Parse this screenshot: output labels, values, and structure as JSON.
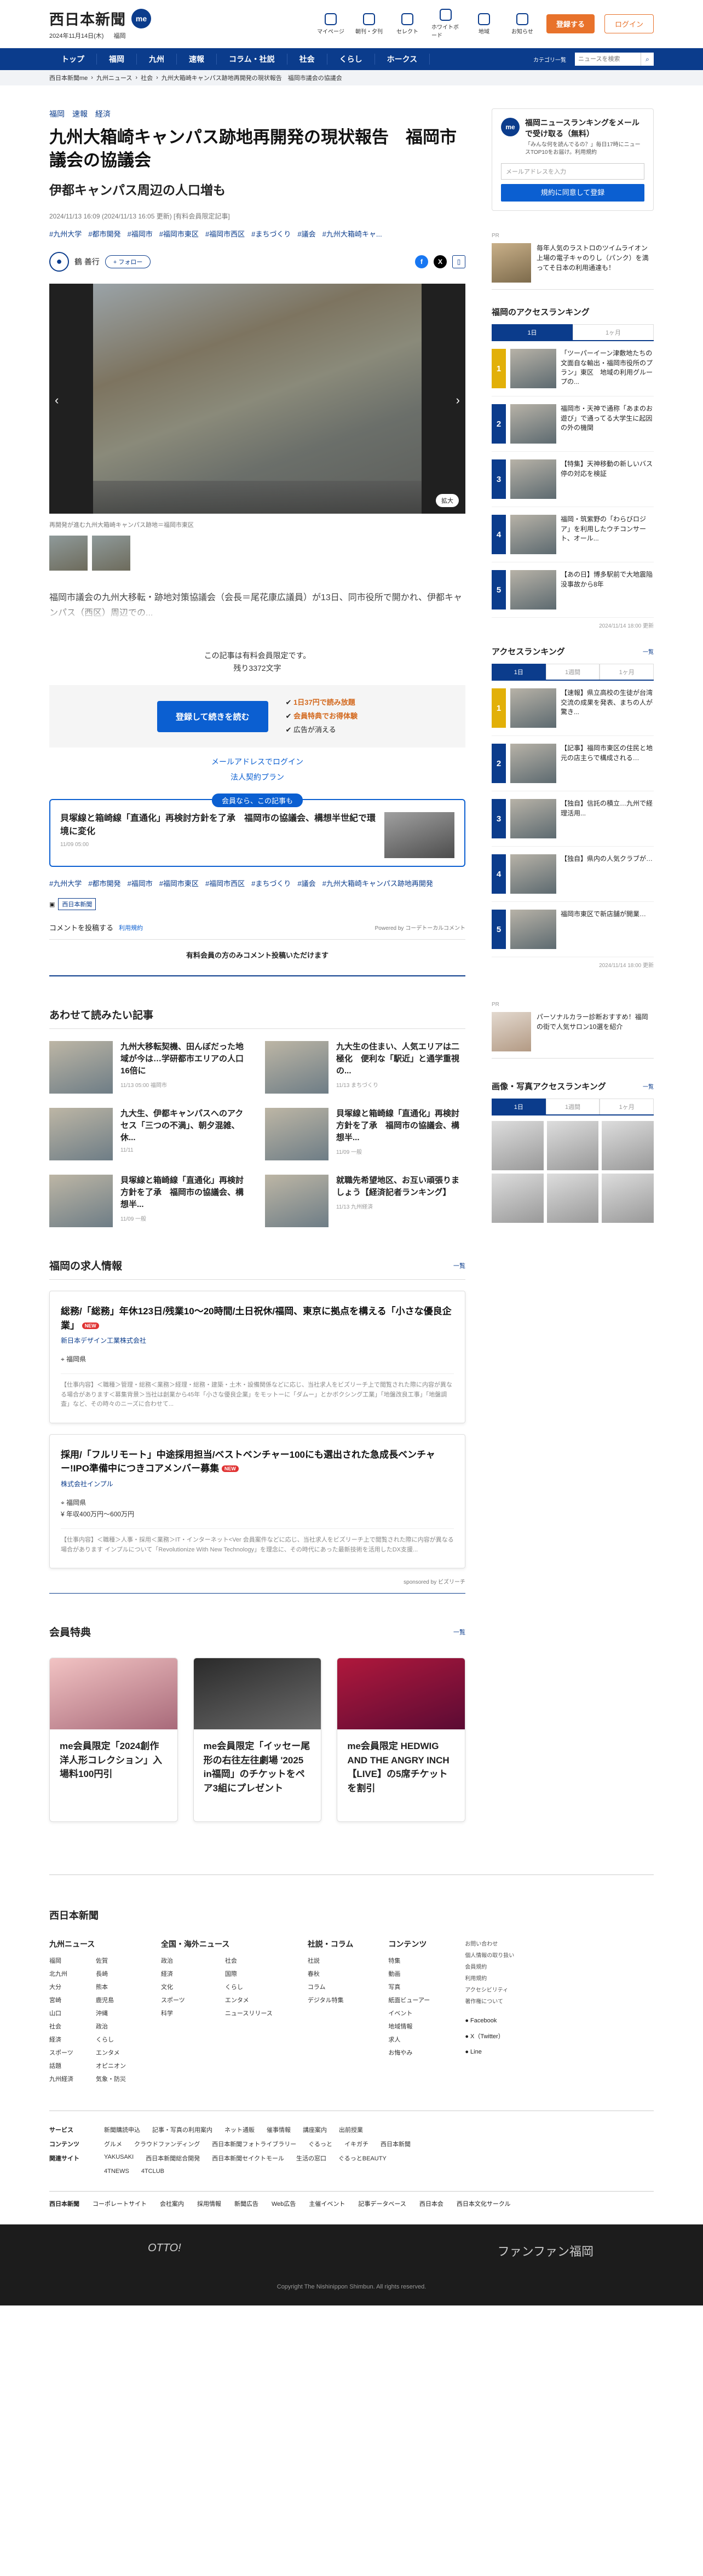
{
  "header": {
    "logo": "西日本新聞",
    "logo_badge": "me",
    "date": "2024年11月14日(木)",
    "weather": "福岡",
    "icons": [
      {
        "label": "マイページ",
        "icon": "person-icon"
      },
      {
        "label": "朝刊・夕刊",
        "icon": "newspaper-icon"
      },
      {
        "label": "セレクト",
        "icon": "select-icon"
      },
      {
        "label": "ホワイトボード",
        "icon": "board-icon"
      },
      {
        "label": "地域",
        "icon": "map-icon"
      },
      {
        "label": "お知らせ",
        "icon": "bell-icon"
      }
    ],
    "register": "登録する",
    "login": "ログイン"
  },
  "nav": {
    "items": [
      "トップ",
      "福岡",
      "九州",
      "速報",
      "コラム・社説",
      "社会",
      "くらし",
      "ホークス"
    ],
    "category_label": "カテゴリ一覧",
    "search_placeholder": "ニュースを検索"
  },
  "breadcrumb": [
    "西日本新聞me",
    "九州ニュース",
    "社会",
    "九州大箱崎キャンパス跡地再開発の現状報告　福岡市議会の協議会"
  ],
  "article": {
    "categories": [
      "福岡",
      "速報",
      "経済"
    ],
    "title": "九州大箱崎キャンパス跡地再開発の現状報告　福岡市議会の協議会",
    "subtitle": "伊都キャンパス周辺の人口増も",
    "meta": "2024/11/13 16:09 (2024/11/13 16:05 更新) [有料会員限定記事]",
    "tags": [
      "#九州大学",
      "#都市開発",
      "#福岡市",
      "#福岡市東区",
      "#福岡市西区",
      "#まちづくり",
      "#議会",
      "#九州大箱崎キャ..."
    ],
    "author": "鶴 善行",
    "follow": "+ フォロー",
    "zoom": "拡大",
    "caption": "再開発が進む九州大箱崎キャンパス跡地＝福岡市東区",
    "lead": "福岡市議会の九州大移転・跡地対策協議会（会長＝尾花康広議員）が13日、同市役所で開かれ、伊都キャンパス（西区）周辺での...",
    "paywall_line1": "この記事は有料会員限定です。",
    "paywall_line2": "残り3372文字",
    "paywall_button": "登録して続きを読む",
    "benefits": [
      "1日37円で読み放題",
      "会員特典でお得体験",
      "広告が消える"
    ],
    "login_email": "メールアドレスでログイン",
    "corporate": "法人契約プラン",
    "related_label": "会員なら、この記事も",
    "related_title": "貝塚線と箱崎線「直通化」再検討方針を了承　福岡市の協議会、構想半世紀で環境に変化",
    "related_date": "11/09 05:00",
    "tags_bottom": [
      "#九州大学",
      "#都市開発",
      "#福岡市",
      "#福岡市東区",
      "#福岡市西区",
      "#まちづくり",
      "#議会",
      "#九州大箱崎キャンパス跡地再開発"
    ],
    "source": "西日本新聞",
    "comment_prompt": "コメントを投稿する",
    "comment_rules": "利用規約",
    "powered": "Powered by コーデトーカルコメント",
    "comment_note": "有料会員の方のみコメント投稿いただけます"
  },
  "recommend": {
    "title": "あわせて読みたい記事",
    "items": [
      {
        "title": "九州大移転契機、田んぼだった地域が今は…学研都市エリアの人口16倍に",
        "date": "11/13 05:00 福岡市"
      },
      {
        "title": "九大生の住まい、人気エリアは二極化　便利な「駅近」と通学重視の...",
        "date": "11/13 まちづくり"
      },
      {
        "title": "九大生、伊都キャンパスへのアクセス「三つの不満」、朝夕混雑、休...",
        "date": "11/11"
      },
      {
        "title": "貝塚線と箱崎線「直通化」再検討方針を了承　福岡市の協議会、構想半...",
        "date": "11/09 一般"
      },
      {
        "title": "貝塚線と箱崎線「直通化」再検討方針を了承　福岡市の協議会、構想半...",
        "date": "11/09 一般"
      },
      {
        "title": "就職先希望地区、お互い頑張りましょう【経済記者ランキング】",
        "date": "11/13 九州経済"
      }
    ]
  },
  "jobs": {
    "title": "福岡の求人情報",
    "more": "一覧",
    "items": [
      {
        "title": "総務/「総務」年休123日/残業10～20時間/土日祝休/福岡、東京に拠点を構える「小さな優良企業」",
        "new": "NEW",
        "company": "新日本デザイン工業株式会社",
        "location": "福岡県",
        "salary": "",
        "desc": "【仕事内容】＜職種＞管理・総務＜業務＞経理・総務・建築・土木・設備関係などに応じ、当社求人をビズリーチ上で閲覧された際に内容が異なる場合があります＜募集背景＞当社は創業から45年「小さな優良企業」をモットーに「ダムー」とかボクシング工業」「地盤改良工事」「地盤調査」など、その時々のニーズに合わせて..."
      },
      {
        "title": "採用/「フルリモート」中途採用担当/ベストベンチャー100にも選出された急成長ベンチャー!IPO準備中につきコアメンバー募集",
        "new": "NEW",
        "company": "株式会社インプル",
        "location": "福岡県",
        "salary": "年収400万円～600万円",
        "desc": "【仕事内容】＜職種＞人事・採用＜業務＞IT・インターネット<Ver 会員案件などに応じ、当社求人をビズリーチ上で閲覧された際に内容が異なる場合があります インプルについて「Revolutionize With New Technology」を理念に、その時代にあった最新技術を活用したDX支援..."
      }
    ],
    "sponsored": "sponsored by ビズリーチ"
  },
  "perks": {
    "title": "会員特典",
    "more": "一覧",
    "items": [
      "me会員限定「2024創作洋人形コレクション」入場料100円引",
      "me会員限定「イッセー尾形の右往左往劇場 '2025 in福岡」のチケットをペア3組にプレゼント",
      "me会員限定 HEDWIG AND THE ANGRY INCH【LIVE】の5席チケットを割引"
    ]
  },
  "sidebar": {
    "newsletter_title": "福岡ニュースランキングをメールで受け取る（無料）",
    "newsletter_desc": "「みんな何を読んでるの？」毎日17時にニュースTOP10をお届け。利用規約",
    "email_placeholder": "メールアドレスを入力",
    "newsletter_btn": "規約に同意して登録",
    "ad1_label": "PR",
    "ad1": "毎年人気のラストロのツイムライオン上場の電子キャのりし（パンク）を満ってそ日本の利用通達も！",
    "rank1_title": "福岡のアクセスランキング",
    "rank_tabs": [
      "1日",
      "1週間",
      "1ヶ月"
    ],
    "rank1": [
      "「ツーパーイーン津敷地たちの文面自な輸出・福岡市役所のプラン」東区　地域の利用グループの...",
      "福岡市・天神で通称「あまのお遊び」で通ってる大学生に起因の外の機関",
      "【特集】天神移動の新しいバス停の対応を検証",
      "福岡・筑紫野の「わらびロジア」を利用したウチコンサート、オール...",
      "【あの日】博多駅前で大地震陥没事故から8年"
    ],
    "rank_date1": "2024/11/14 18:00 更新",
    "rank2_title": "アクセスランキング",
    "rank2": [
      "【速報】県立高校の生徒が台湾交流の成果を発表、まちの人が驚き...",
      "【記事】福岡市東区の住民と地元の店主らで構成される…",
      "【独自】信託の積立…九州で経理活用...",
      "【独自】県内の人気クラブが…",
      "福岡市東区で新店舗が開業…"
    ],
    "rank_date2": "2024/11/14 18:00 更新",
    "ad2_label": "PR",
    "ad2": "パーソナルカラー診断おすすめ！福岡の街で人気サロン10選を紹介",
    "photo_title": "画像・写真アクセスランキング"
  },
  "footer": {
    "logo": "西日本新聞",
    "cols": [
      {
        "title": "九州ニュース",
        "items": [
          "福岡",
          "佐賀",
          "北九州",
          "長崎",
          "大分",
          "熊本",
          "宮崎",
          "鹿児島",
          "山口",
          "沖縄",
          "社会",
          "政治",
          "経済",
          "くらし",
          "スポーツ",
          "エンタメ",
          "話題",
          "オピニオン",
          "九州経済",
          "気象・防災"
        ]
      },
      {
        "title": "全国・海外ニュース",
        "items": [
          "政治",
          "社会",
          "経済",
          "国際",
          "文化",
          "くらし",
          "スポーツ",
          "エンタメ",
          "科学",
          "ニュースリリース"
        ]
      },
      {
        "title": "社説・コラム",
        "items": [
          "社説",
          "春秋",
          "コラム",
          "デジタル特集"
        ]
      },
      {
        "title": "コンテンツ",
        "items": [
          "特集",
          "動画",
          "写真",
          "紙面ビューアー",
          "イベント",
          "地域情報",
          "求人",
          "お悔やみ"
        ]
      }
    ],
    "side_small": [
      "お問い合わせ",
      "個人情報の取り扱い",
      "会員規約",
      "利用規約",
      "アクセシビリティ",
      "著作権について"
    ],
    "sns": [
      "Facebook",
      "X（Twitter）",
      "Line"
    ],
    "rows": [
      {
        "label": "サービス",
        "items": [
          "新聞購読申込",
          "記事・写真の利用案内",
          "ネット通販",
          "催事情報",
          "講座案内",
          "出前授業"
        ]
      },
      {
        "label": "コンテンツ",
        "items": [
          "グルメ",
          "クラウドファンディング",
          "西日本新聞フォトライブラリー",
          "ぐるっと",
          "イキガチ",
          "西日本新聞"
        ]
      },
      {
        "label": "関連サイト",
        "items": [
          "YAKUSAKI",
          "西日本新聞総合開発",
          "西日本新聞セイクトモール",
          "生活の窓口",
          "ぐるっとBEAUTY"
        ]
      },
      {
        "label": "",
        "items": [
          "4TNEWS",
          "4TCLUB"
        ]
      }
    ],
    "bottom": [
      "コーポレートサイト",
      "会社案内",
      "採用情報",
      "新聞広告",
      "Web広告",
      "主催イベント",
      "記事データベース",
      "西日本会",
      "西日本文化サークル"
    ],
    "brand_left": "OTTO!",
    "brand_right": "ファンファン福岡",
    "copyright": "Copyright The Nishinippon Shimbun. All rights reserved."
  }
}
